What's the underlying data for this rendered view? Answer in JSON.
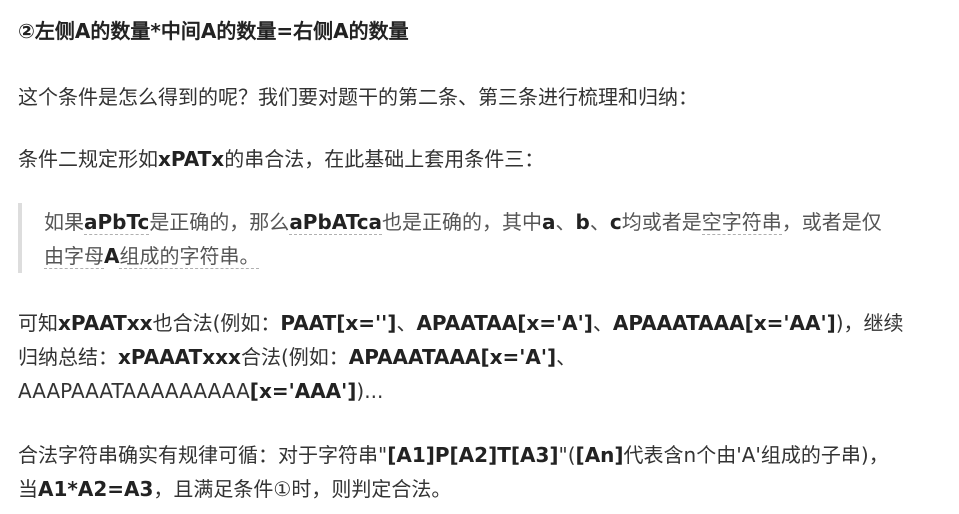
{
  "heading": "②左侧A的数量*中间A的数量=右侧A的数量",
  "para1": "这个条件是怎么得到的呢？我们要对题干的第二条、第三条进行梳理和归纳：",
  "para2": {
    "pre": "条件二规定形如",
    "b1": "xPATx",
    "post": "的串合法，在此基础上套用条件三："
  },
  "quote": {
    "l1_p1": "如果",
    "l1_b1": "aPbTc",
    "l1_p2": "是正确的，那么",
    "l1_b2": "aPbATca",
    "l1_p3": "也是正确的，其中",
    "l1_b3": "a",
    "l1_p4": "、",
    "l1_b4": "b",
    "l1_p5": "、",
    "l1_b5": "c",
    "l1_p6": "均或者是",
    "l1_u1": "空字符串",
    "l1_p7": "，或者是仅",
    "l2_p1": "由字母",
    "l2_b1": "A",
    "l2_p2": "组成的字符串。"
  },
  "para3": {
    "l1_p1": "可知",
    "l1_b1": "xPAATxx",
    "l1_p2": "也合法(例如：",
    "l1_b2": "PAAT[x='']",
    "l1_p3": "、",
    "l1_b3": "APAATAA[x='A']",
    "l1_p4": "、",
    "l1_b4": "APAAATAAA[x='AA']",
    "l1_p5": ")，继续",
    "l2_p1": "归纳总结：",
    "l2_b1": "xPAAATxxx",
    "l2_p2": "合法(例如：",
    "l2_b2": "APAAATAAA[x='A']",
    "l2_p3": "、",
    "l3_p1": "AAAPAAATAAAAAAAAA",
    "l3_b1": "[x='AAA']",
    "l3_p2": ")..."
  },
  "para4": {
    "l1_p1": "合法字符串确实有规律可循：对于字符串\"",
    "l1_b1": "[A1]P[A2]T[A3]",
    "l1_p2": "\"(",
    "l1_b2": "[An]",
    "l1_p3": "代表含n个由'A'组成的子串)，",
    "l2_p1": "当",
    "l2_b1": "A1*A2=A3",
    "l2_p2": "，且满足条件①时，则判定合法。"
  },
  "colors": {
    "text": "#333333",
    "bold": "#222222",
    "quote_text": "#555555",
    "quote_bar": "#dddddd"
  }
}
